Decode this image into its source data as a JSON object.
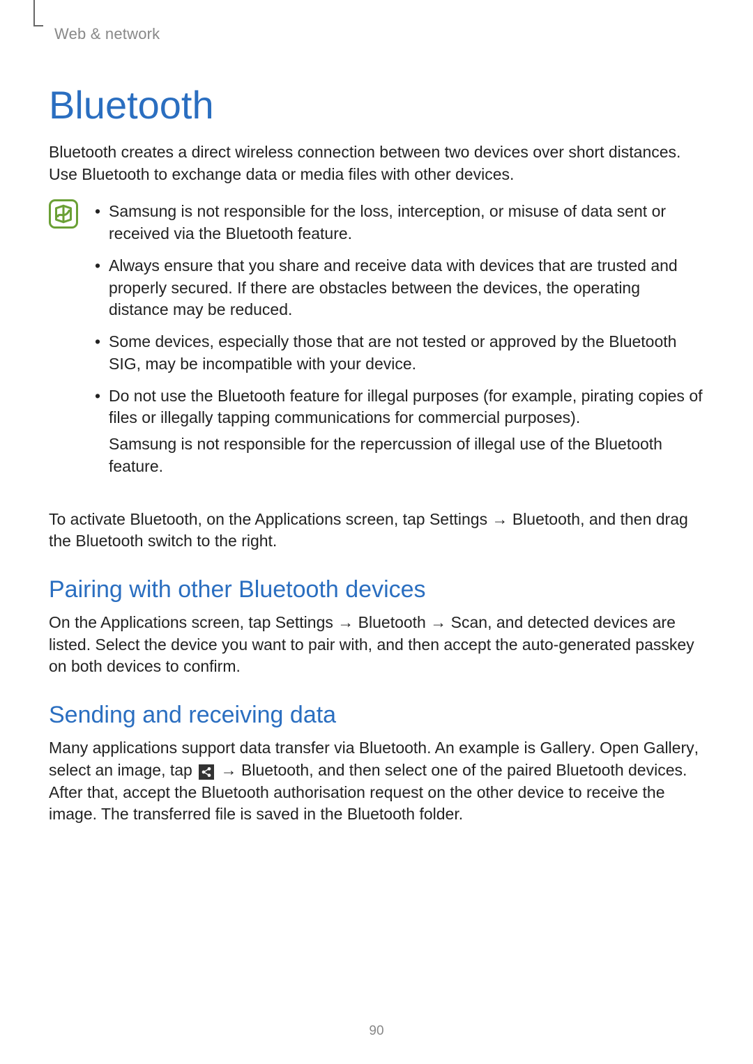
{
  "header": "Web & network",
  "h1": "Bluetooth",
  "intro": "Bluetooth creates a direct wireless connection between two devices over short distances. Use Bluetooth to exchange data or media files with other devices.",
  "notes": [
    {
      "text": "Samsung is not responsible for the loss, interception, or misuse of data sent or received via the Bluetooth feature."
    },
    {
      "text": "Always ensure that you share and receive data with devices that are trusted and properly secured. If there are obstacles between the devices, the operating distance may be reduced."
    },
    {
      "text": "Some devices, especially those that are not tested or approved by the Bluetooth SIG, may be incompatible with your device."
    },
    {
      "text": "Do not use the Bluetooth feature for illegal purposes (for example, pirating copies of files or illegally tapping communications for commercial purposes).",
      "extra": "Samsung is not responsible for the repercussion of illegal use of the Bluetooth feature."
    }
  ],
  "activate": {
    "pre": "To activate Bluetooth, on the Applications screen, tap ",
    "settings": "Settings",
    "arrow1": " → ",
    "bt": "Bluetooth",
    "mid": ", and then drag the ",
    "btswitch": "Bluetooth",
    "post": " switch to the right."
  },
  "pairing": {
    "h2": "Pairing with other Bluetooth devices",
    "pre": "On the Applications screen, tap ",
    "settings": "Settings",
    "arrow1": " → ",
    "bt": "Bluetooth",
    "arrow2": " → ",
    "scan": "Scan",
    "post": ", and detected devices are listed. Select the device you want to pair with, and then accept the auto-generated passkey on both devices to confirm."
  },
  "sending": {
    "h2": "Sending and receiving data",
    "pre": "Many applications support data transfer via Bluetooth. An example is ",
    "g1": "Gallery",
    "dotOpen": ". Open ",
    "g2": "Gallery",
    "selectImg": ", select an image, tap ",
    "arrow": " → ",
    "bt": "Bluetooth",
    "afterBt": ", and then select one of the paired Bluetooth devices. After that, accept the Bluetooth authorisation request on the other device to receive the image. The transferred file is saved in the ",
    "folder": "Bluetooth",
    "end": " folder."
  },
  "pageNum": "90"
}
